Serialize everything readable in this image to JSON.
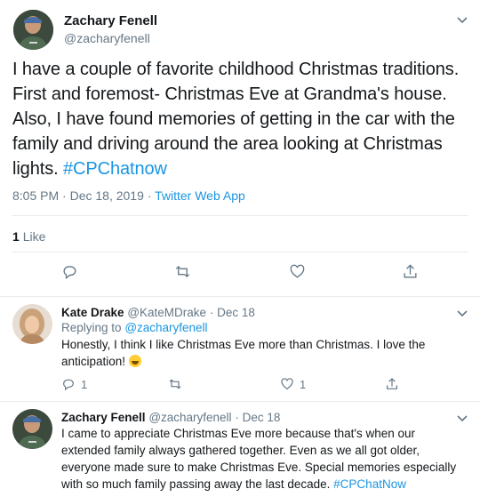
{
  "main_tweet": {
    "author_name": "Zachary Fenell",
    "author_handle": "@zacharyfenell",
    "body_lines": [
      "I have a couple of favorite childhood Christmas traditions.",
      "First and foremost- Christmas Eve at Grandma's house.",
      "Also, I have found memories of getting in the car with the",
      "family and driving around the area looking at Christmas"
    ],
    "body_last_line": "lights.",
    "hashtag": "#CPChatnow",
    "time": "8:05 PM",
    "date": "Dec 18, 2019",
    "source": "Twitter Web App",
    "like_count": "1",
    "like_label": "Like"
  },
  "replies": [
    {
      "author_name": "Kate Drake",
      "author_handle": "@KateMDrake",
      "date": "Dec 18",
      "replying_label": "Replying to",
      "replying_to": "@zacharyfenell",
      "body_line1": "Honestly, I think I like Christmas Eve more than Christmas. I love the",
      "body_line2": "anticipation!",
      "reply_count": "1",
      "like_count": "1"
    },
    {
      "author_name": "Zachary Fenell",
      "author_handle": "@zacharyfenell",
      "date": "Dec 18",
      "body_lines": [
        "I came to appreciate Christmas Eve more because that's when our",
        "extended family always gathered together. Even as we all got older,",
        "everyone made sure to make Christmas Eve. Special memories especially"
      ],
      "body_last_line": "with so much family passing away the last decade.",
      "hashtag": "#CPChatNow"
    }
  ],
  "separator": "·",
  "icons": {
    "reply": "reply-icon",
    "retweet": "retweet-icon",
    "like": "heart-icon",
    "share": "share-icon",
    "more": "chevron-down-icon"
  },
  "colors": {
    "link": "#1b95e0",
    "muted": "#657786",
    "text": "#14171a",
    "divider": "#e6ecf0"
  }
}
